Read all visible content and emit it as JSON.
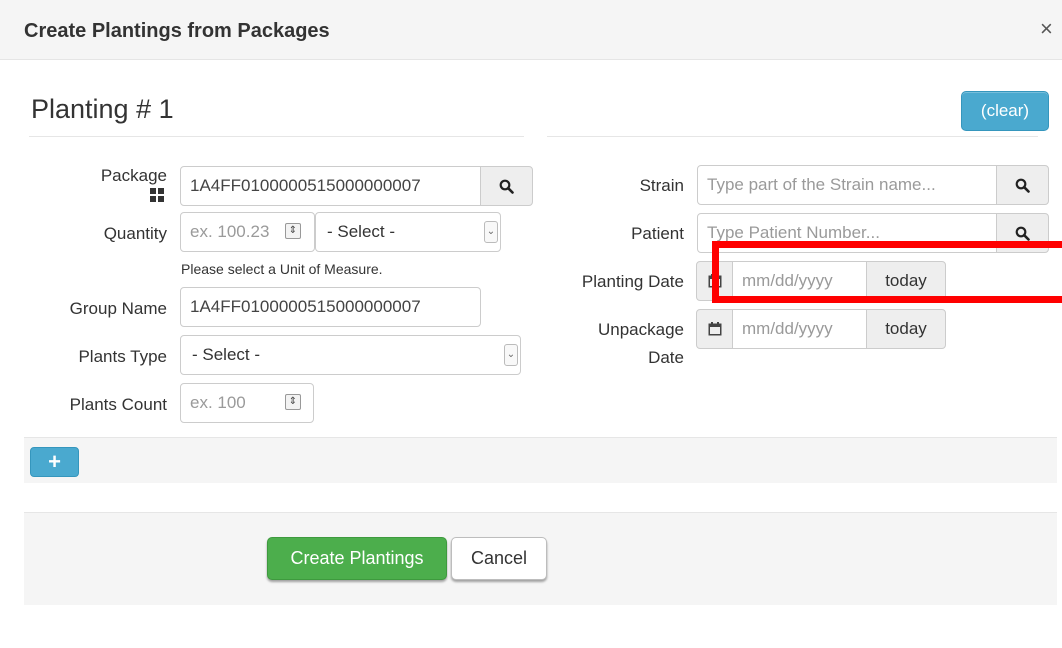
{
  "modal": {
    "title": "Create Plantings from Packages",
    "close_glyph": "×"
  },
  "planting": {
    "title": "Planting # 1",
    "clear_label": "(clear)"
  },
  "fields": {
    "package": {
      "label": "Package",
      "value": "1A4FF0100000515000000007"
    },
    "quantity": {
      "label": "Quantity",
      "placeholder": "ex. 100.23",
      "unit_select": "- Select -",
      "help": "Please select a Unit of Measure."
    },
    "group_name": {
      "label": "Group Name",
      "value": "1A4FF0100000515000000007"
    },
    "plants_type": {
      "label": "Plants Type",
      "select": "- Select -"
    },
    "plants_count": {
      "label": "Plants Count",
      "placeholder": "ex. 100"
    },
    "strain": {
      "label": "Strain",
      "placeholder": "Type part of the Strain name..."
    },
    "patient": {
      "label": "Patient",
      "placeholder": "Type Patient Number..."
    },
    "planting_date": {
      "label": "Planting Date",
      "placeholder": "mm/dd/yyyy",
      "today_label": "today"
    },
    "unpackage_date": {
      "label_line1": "Unpackage",
      "label_line2": "Date",
      "placeholder": "mm/dd/yyyy",
      "today_label": "today"
    }
  },
  "footer": {
    "create_label": "Create Plantings",
    "cancel_label": "Cancel"
  },
  "icons": {
    "search": "search-icon",
    "calendar": "calendar-icon",
    "grid": "grid-icon",
    "plus": "plus-icon",
    "close": "close-icon"
  },
  "colors": {
    "info_button": "#4aa9cf",
    "success_button": "#4cae4c",
    "highlight": "#ff0000"
  }
}
